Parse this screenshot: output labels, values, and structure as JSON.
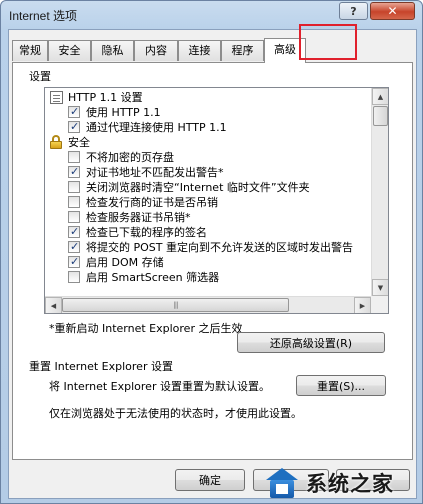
{
  "window": {
    "title": "Internet 选项",
    "help_label": "?",
    "close_label": "✕"
  },
  "tabs": [
    {
      "label": "常规",
      "active": false
    },
    {
      "label": "安全",
      "active": false
    },
    {
      "label": "隐私",
      "active": false
    },
    {
      "label": "内容",
      "active": false
    },
    {
      "label": "连接",
      "active": false
    },
    {
      "label": "程序",
      "active": false
    },
    {
      "label": "高级",
      "active": true
    }
  ],
  "settings": {
    "group_label": "设置",
    "items": [
      {
        "type": "section",
        "icon": "document-icon",
        "text": "HTTP 1.1 设置"
      },
      {
        "type": "checkbox",
        "checked": true,
        "text": "使用 HTTP 1.1"
      },
      {
        "type": "checkbox",
        "checked": true,
        "text": "通过代理连接使用 HTTP 1.1"
      },
      {
        "type": "section",
        "icon": "lock-icon",
        "text": "安全"
      },
      {
        "type": "checkbox",
        "checked": false,
        "text": "不将加密的页存盘"
      },
      {
        "type": "checkbox",
        "checked": true,
        "text": "对证书地址不匹配发出警告*"
      },
      {
        "type": "checkbox",
        "checked": false,
        "text": "关闭浏览器时清空“Internet 临时文件”文件夹"
      },
      {
        "type": "checkbox",
        "checked": false,
        "text": "检查发行商的证书是否吊销"
      },
      {
        "type": "checkbox",
        "checked": false,
        "text": "检查服务器证书吊销*"
      },
      {
        "type": "checkbox",
        "checked": true,
        "text": "检查已下载的程序的签名"
      },
      {
        "type": "checkbox",
        "checked": true,
        "text": "将提交的 POST 重定向到不允许发送的区域时发出警告"
      },
      {
        "type": "checkbox",
        "checked": true,
        "text": "启用 DOM 存储"
      },
      {
        "type": "checkbox",
        "checked": false,
        "text": "启用 SmartScreen 筛选器"
      }
    ],
    "restart_note": "*重新启动 Internet Explorer 之后生效",
    "restore_button": "还原高级设置(R)"
  },
  "reset": {
    "heading": "重置 Internet Explorer 设置",
    "description": "将 Internet Explorer 设置重置为默认设置。",
    "button": "重置(S)...",
    "note": "仅在浏览器处于无法使用的状态时，才使用此设置。"
  },
  "footer": {
    "ok": "确定",
    "cancel": "",
    "apply": ""
  },
  "watermark": {
    "text": "系统之家"
  },
  "colors": {
    "highlight": "#e0202c",
    "titlebar": "#b9d1ea",
    "close_button": "#c7442b"
  }
}
